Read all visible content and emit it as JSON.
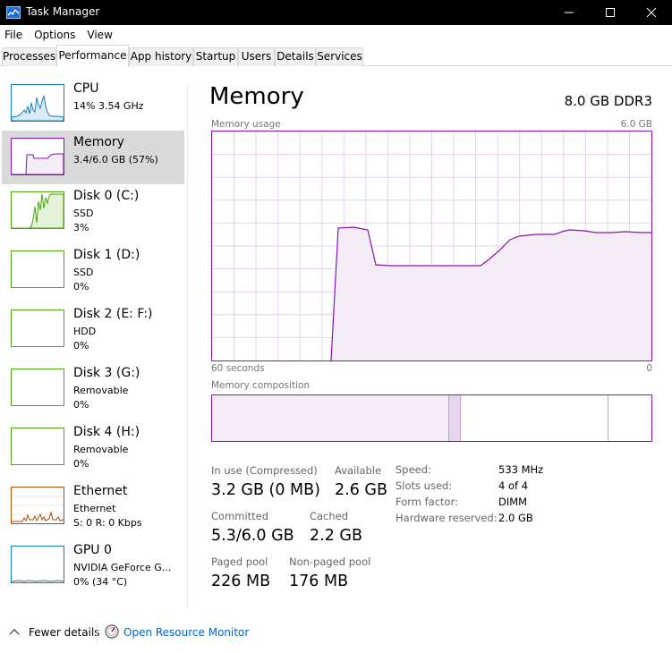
{
  "window": {
    "title": "Task Manager"
  },
  "menu": [
    "File",
    "Options",
    "View"
  ],
  "tabs": [
    "Processes",
    "Performance",
    "App history",
    "Startup",
    "Users",
    "Details",
    "Services"
  ],
  "sidebar": [
    {
      "name": "CPU",
      "line1": "14%  3.54 GHz",
      "line2": ""
    },
    {
      "name": "Memory",
      "line1": "3.4/6.0 GB (57%)",
      "line2": ""
    },
    {
      "name": "Disk 0 (C:)",
      "line1": "SSD",
      "line2": "3%"
    },
    {
      "name": "Disk 1 (D:)",
      "line1": "SSD",
      "line2": "0%"
    },
    {
      "name": "Disk 2 (E: F:)",
      "line1": "HDD",
      "line2": "0%"
    },
    {
      "name": "Disk 3 (G:)",
      "line1": "Removable",
      "line2": "0%"
    },
    {
      "name": "Disk 4 (H:)",
      "line1": "Removable",
      "line2": "0%"
    },
    {
      "name": "Ethernet",
      "line1": "Ethernet",
      "line2": "S: 0  R: 0 Kbps"
    },
    {
      "name": "GPU 0",
      "line1": "NVIDIA GeForce G...",
      "line2": "0%  (34 °C)"
    }
  ],
  "main": {
    "title": "Memory",
    "spec": "8.0 GB DDR3",
    "usage_label": "Memory usage",
    "usage_max": "6.0 GB",
    "time_left": "60 seconds",
    "time_right": "0",
    "composition_label": "Memory composition",
    "stats": {
      "in_use_label": "In use (Compressed)",
      "in_use_value": "3.2 GB (0 MB)",
      "available_label": "Available",
      "available_value": "2.6 GB",
      "committed_label": "Committed",
      "committed_value": "5.3/6.0 GB",
      "cached_label": "Cached",
      "cached_value": "2.2 GB",
      "paged_label": "Paged pool",
      "paged_value": "226 MB",
      "nonpaged_label": "Non-paged pool",
      "nonpaged_value": "176 MB"
    },
    "details": [
      {
        "label": "Speed:",
        "value": "533 MHz"
      },
      {
        "label": "Slots used:",
        "value": "4 of 4"
      },
      {
        "label": "Form factor:",
        "value": "DIMM"
      },
      {
        "label": "Hardware reserved:",
        "value": "2.0 GB"
      }
    ]
  },
  "footer": {
    "fewer_details": "Fewer details",
    "resource_monitor": "Open Resource Monitor"
  },
  "colors": {
    "memory": "#8b12ae",
    "cpu": "#117dbb",
    "disk": "#4da60c",
    "ethernet": "#a74f01",
    "gpu": "#117dbb",
    "accent_link": "#0066cc"
  }
}
